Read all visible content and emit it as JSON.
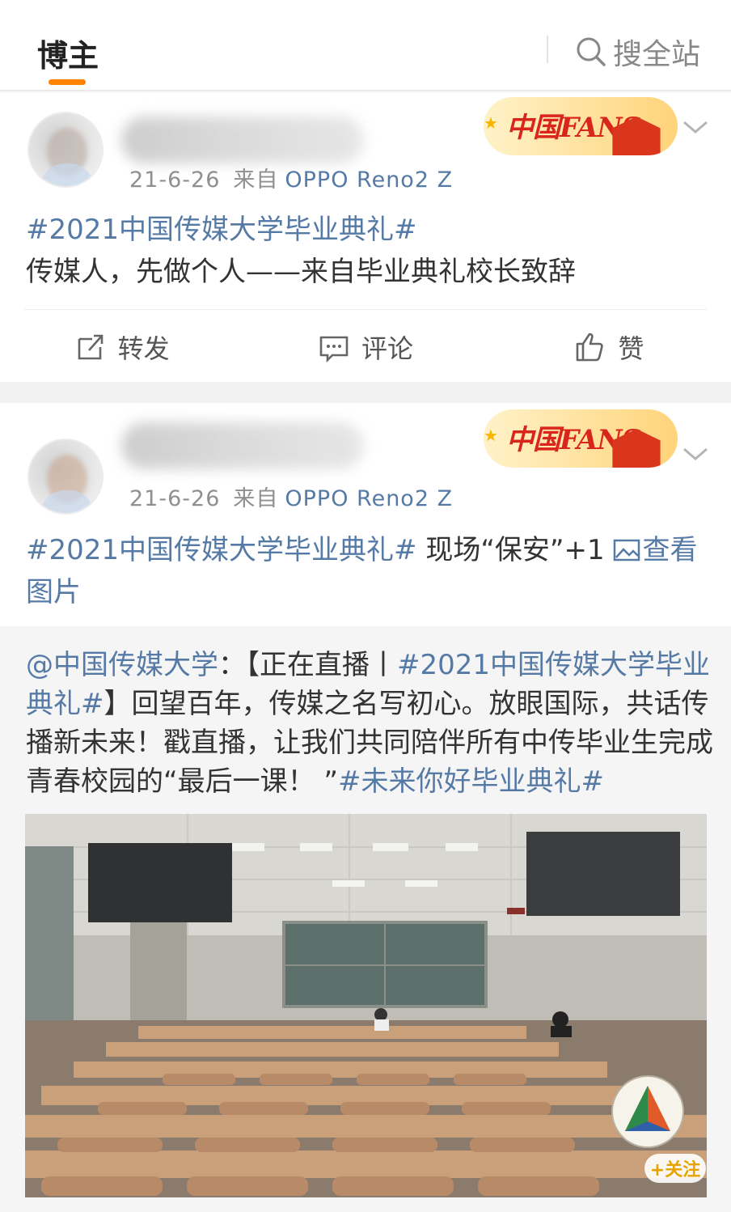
{
  "nav": {
    "tab_active": "博主",
    "search_label": "搜全站"
  },
  "posts": [
    {
      "date": "21-6-26",
      "source_prefix": "来自",
      "device": "OPPO Reno2 Z",
      "badge": "中国FANS",
      "topic": "#2021中国传媒大学毕业典礼#",
      "body": "传媒人，先做个人——来自毕业典礼校长致辞",
      "actions": {
        "repost": "转发",
        "comment": "评论",
        "like": "赞"
      }
    },
    {
      "date": "21-6-26",
      "source_prefix": "来自",
      "device": "OPPO Reno2 Z",
      "badge": "中国FANS",
      "topic": "#2021中国传媒大学毕业典礼#",
      "body": " 现场“保安”+1 ",
      "view_image": "查看图片",
      "repost": {
        "mention": "@中国传媒大学",
        "sep": "：【正在直播丨",
        "topic1": "#2021中国传媒大学毕业典礼#",
        "text": "】回望百年，传媒之名写初心。放眼国际，共话传播新未来！戳直播，让我们共同陪伴所有中传毕业生完成青春校园的“最后一课！ ”",
        "topic2": "#未来你好毕业典礼#",
        "follow_label": "+关注"
      }
    }
  ],
  "colors": {
    "accent": "#ff8200",
    "link": "#567aa6"
  },
  "icons": [
    "search-icon",
    "chevron-down-icon",
    "repost-icon",
    "comment-icon",
    "like-icon",
    "image-icon"
  ]
}
